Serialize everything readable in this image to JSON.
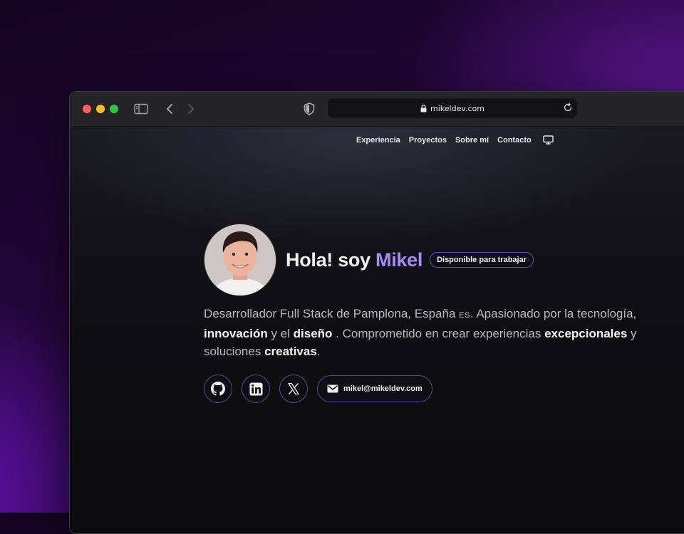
{
  "browser": {
    "url": "mikeldev.com"
  },
  "nav": {
    "items": [
      {
        "label": "Experiencia"
      },
      {
        "label": "Proyectos"
      },
      {
        "label": "Sobre mí"
      },
      {
        "label": "Contacto"
      }
    ],
    "theme_icon": "monitor-icon"
  },
  "hero": {
    "greeting": "Hola! soy",
    "name": "Mikel",
    "badge": "Disponible para trabajar",
    "description": {
      "line1_a": "Desarrollador Full Stack de Pamplona, España",
      "flag": "ES",
      "line1_b": ". Apasionado por la tecnología,",
      "line2_hl1": "innovación",
      "line2_a": " y el ",
      "line2_hl2": "diseño",
      "line2_b": " . Comprometido en crear experiencias ",
      "line2_hl3": "excepcionales",
      "line2_c": " y",
      "line3_a": "soluciones ",
      "line3_hl": "creativas",
      "line3_b": "."
    }
  },
  "socials": {
    "items": [
      {
        "icon": "github-icon"
      },
      {
        "icon": "linkedin-icon"
      },
      {
        "icon": "x-icon"
      }
    ],
    "email": "mikel@mikeldev.com"
  },
  "colors": {
    "accent": "#a78bfa",
    "badge_border": "#5b55c8",
    "page_bg": "#0d0d10"
  }
}
